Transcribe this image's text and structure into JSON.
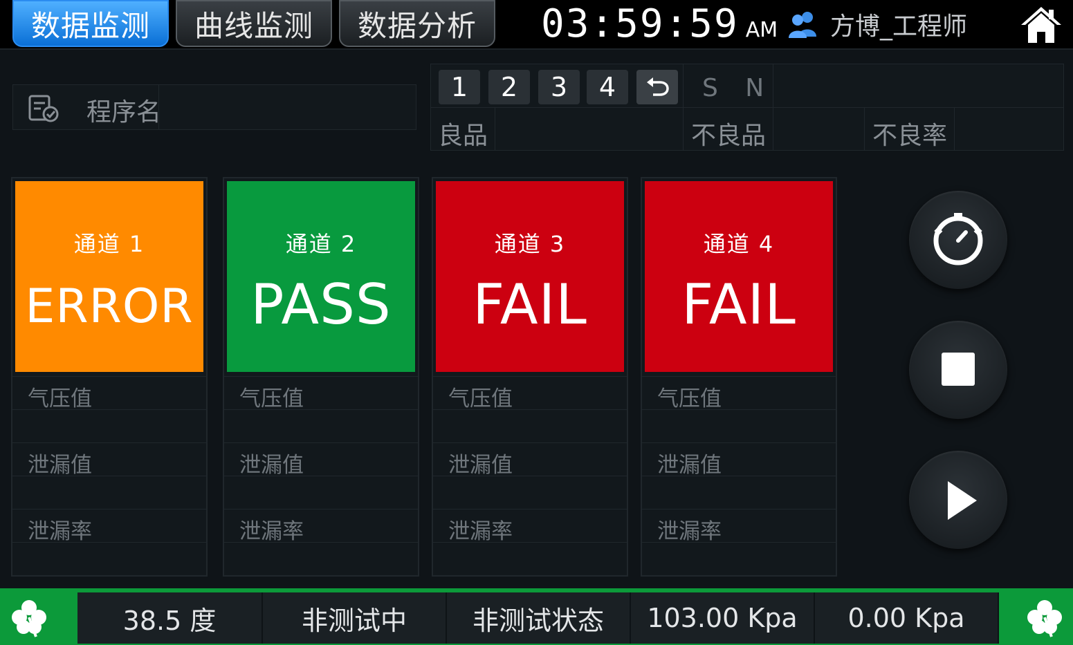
{
  "tabs": [
    {
      "label": "数据监测",
      "active": true
    },
    {
      "label": "曲线监测",
      "active": false
    },
    {
      "label": "数据分析",
      "active": false
    }
  ],
  "clock": {
    "time": "03:59:59",
    "ampm": "AM"
  },
  "user": {
    "name": "方博_工程师",
    "icon": "users-icon"
  },
  "program": {
    "label": "程序名",
    "value": ""
  },
  "channel_buttons": [
    "1",
    "2",
    "3",
    "4"
  ],
  "stats": {
    "sn_label": "S N",
    "good_label": "良品",
    "good_value": "",
    "bad_label": "不良品",
    "bad_value": "",
    "bad_rate_label": "不良率",
    "bad_rate_value": ""
  },
  "channels": [
    {
      "name": "通道 1",
      "state": "ERROR",
      "color": "#ff8a00",
      "pressure_label": "气压值",
      "pressure": "",
      "leak_label": "泄漏值",
      "leak": "",
      "leak_rate_label": "泄漏率",
      "leak_rate": ""
    },
    {
      "name": "通道 2",
      "state": "PASS",
      "color": "#089a3e",
      "pressure_label": "气压值",
      "pressure": "",
      "leak_label": "泄漏值",
      "leak": "",
      "leak_rate_label": "泄漏率",
      "leak_rate": ""
    },
    {
      "name": "通道 3",
      "state": "FAIL",
      "color": "#cc0010",
      "pressure_label": "气压值",
      "pressure": "",
      "leak_label": "泄漏值",
      "leak": "",
      "leak_rate_label": "泄漏率",
      "leak_rate": ""
    },
    {
      "name": "通道 4",
      "state": "FAIL",
      "color": "#cc0010",
      "pressure_label": "气压值",
      "pressure": "",
      "leak_label": "泄漏值",
      "leak": "",
      "leak_rate_label": "泄漏率",
      "leak_rate": ""
    }
  ],
  "controls": [
    "timer-icon",
    "stop-icon",
    "play-icon"
  ],
  "status_bar": {
    "temperature": "38.5 度",
    "test_state": "非测试中",
    "test_mode": "非测试状态",
    "pressure_1": "103.00 Kpa",
    "pressure_2": "0.00 Kpa"
  },
  "colors": {
    "accent": "#0a6fd6",
    "bar": "#0c9a3a"
  }
}
